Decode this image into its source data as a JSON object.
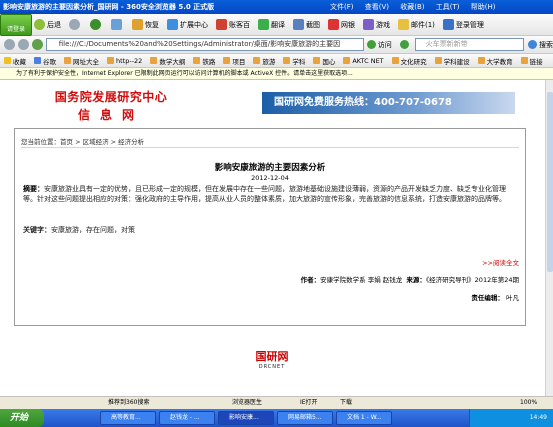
{
  "window": {
    "title": "影响安康旅游的主要因素分析_国研网 - 360安全浏览器 5.0 正式版",
    "menu": [
      "文件(F)",
      "查看(V)",
      "收藏(B)",
      "工具(T)",
      "帮助(H)"
    ]
  },
  "login_badge": "请登录",
  "toolbar": {
    "back": "后退",
    "refresh": "恢复",
    "extensions": "扩展中心",
    "phishing": "账客百",
    "translate": "翻译",
    "screenshot": "截图",
    "netbank": "网银",
    "games": "游戏",
    "mail": "邮件(1)",
    "login_admin": "登录管理"
  },
  "address_bar": {
    "url": "file:///C:/Documents%20and%20Settings/Administrator/桌面/影响安康旅游的主要因",
    "go": "访问",
    "search_placeholder": "火车票新新带",
    "search_button": "搜索"
  },
  "favorites": [
    "收藏",
    "谷歌",
    "网址大全",
    "http--22",
    "数学大纲",
    "铁路",
    "项目",
    "旅游",
    "学科",
    "国心",
    "AKTC NET",
    "文化研究",
    "学科建设",
    "大学教育",
    "链接"
  ],
  "infobar": "为了有利于保护安全性，Internet Explorer 已限制此网页运行可以访问计算机的脚本或 ActiveX 控件。请单击这里获取选项...",
  "site": {
    "logo_line1": "国务院发展研究中心",
    "logo_line2": "信息网",
    "banner_text": "国研网免费服务热线：400-707-0678"
  },
  "article": {
    "breadcrumb": "您当前位置：首页 > 区域经济 > 经济分析",
    "title": "影响安康旅游的主要因素分析",
    "date": "2012-12-04",
    "abstract_label": "摘要：",
    "abstract_text": "安康旅游业具有一定的优势，且已形成一定的规模，但在发展中存在一些问题，旅游地基础设施建设薄弱，资源的产品开发缺乏力度、缺乏专业化管理等。针对这些问题提出相应的对策：强化政府的主导作用，提高从业人员的整体素质，加大旅游的宣传形象，完善旅游的信息系统，打造安康旅游的品牌等。",
    "keywords_label": "关键字：",
    "keywords_text": "安康旅游，存在问题，对策",
    "read_more": ">>阅读全文",
    "author_label": "作者：",
    "author_text": "安康学院数学系  李娟  赵钱龙",
    "source_label": "来源：",
    "source_text": "《经济研究导刊》2012年第24期",
    "editor_label": "责任编辑：",
    "editor_text": "叶凡"
  },
  "footer": {
    "brand": "国研网",
    "sub": "DRCNET"
  },
  "statusbar": {
    "left": "推荐到360搜索",
    "doctor": "浏览器医生",
    "ie": "IE打开",
    "download": "下载",
    "zoom": "100%"
  },
  "taskbar": {
    "start": "开始",
    "tasks": [
      "高等教育...",
      "赵钱龙 - ...",
      "影响安康...",
      "网易邮箱5...",
      "文档 1 - W..."
    ],
    "active_index": 2,
    "clock": "14:49"
  },
  "colors": {
    "title_blue": "#0346c6",
    "logo_red": "#d10d0d",
    "banner_blue": "#1c5ea8",
    "link_red": "#cc0000"
  }
}
